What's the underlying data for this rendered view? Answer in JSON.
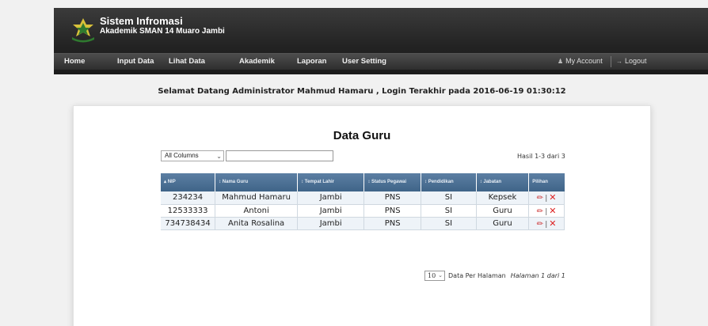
{
  "header": {
    "title": "Sistem Infromasi",
    "subtitle": "Akademik SMAN 14 Muaro Jambi"
  },
  "nav": {
    "items": [
      "Home",
      "Input Data",
      "Lihat Data",
      "Akademik",
      "Laporan",
      "User Setting"
    ],
    "account": "My Account",
    "logout": "Logout"
  },
  "welcome": "Selamat Datang Administrator Mahmud Hamaru , Login Terakhir pada 2016-06-19 01:30:12",
  "page_title": "Data Guru",
  "filter": {
    "column_select": "All Columns",
    "search_value": "",
    "result_info": "Hasil 1-3 dari 3"
  },
  "table": {
    "headers": [
      "NIP",
      "Nama Guru",
      "Tempat Lahir",
      "Status Pegawai",
      "Pendidikan",
      "Jabatan",
      "Pilihan"
    ],
    "rows": [
      [
        "234234",
        "Mahmud Hamaru",
        "Jambi",
        "PNS",
        "SI",
        "Kepsek"
      ],
      [
        "12533333",
        "Antoni",
        "Jambi",
        "PNS",
        "SI",
        "Guru"
      ],
      [
        "734738434",
        "Anita Rosalina",
        "Jambi",
        "PNS",
        "SI",
        "Guru"
      ]
    ]
  },
  "pager": {
    "per_page": "10",
    "per_page_label": "Data Per Halaman",
    "page_info": "Halaman 1 dari 1"
  },
  "icons": {
    "sort": "sort-arrows-icon",
    "edit": "pencil-icon",
    "delete": "cross-icon",
    "account": "user-icon",
    "logout": "arrow-right-icon"
  },
  "colors": {
    "header_bg": "#222222",
    "table_header": "#4a6f95",
    "row_alt": "#eef3f8",
    "delete": "#d22222"
  }
}
